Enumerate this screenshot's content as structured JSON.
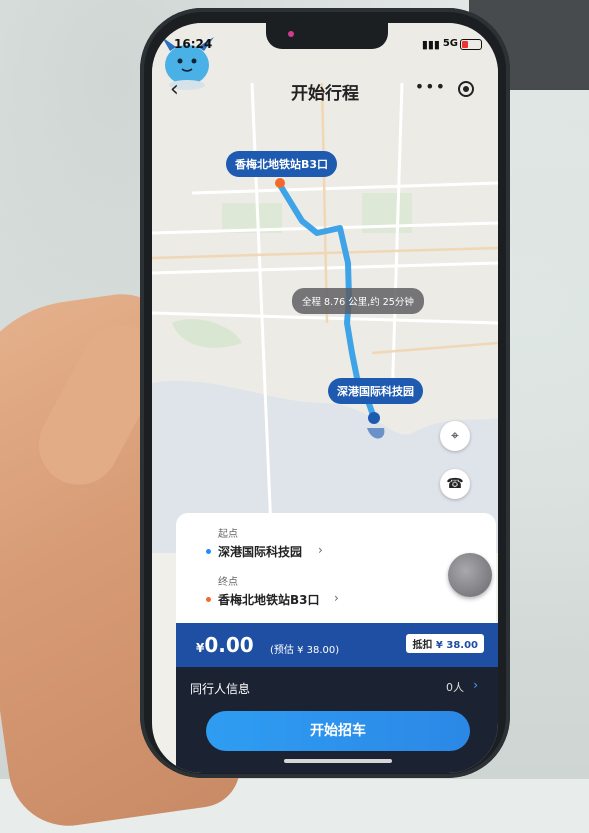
{
  "status_bar": {
    "time": "16:24",
    "network": "5G"
  },
  "header": {
    "title": "开始行程",
    "more_label": "•••"
  },
  "map": {
    "start_bubble": "香梅北地铁站B3口",
    "end_bubble": "深港国际科技园",
    "route_info": "全程 8.76 公里,约 25分钟"
  },
  "trip": {
    "start_label": "起点",
    "start_place": "深港国际科技园",
    "end_label": "终点",
    "end_place": "香梅北地铁站B3口"
  },
  "price": {
    "currency": "¥",
    "amount": "0.00",
    "estimate": "(预估 ¥ 38.00)",
    "deduct_label": "抵扣",
    "deduct_amount": "¥ 38.00"
  },
  "companion": {
    "label": "同行人信息",
    "value": "0人"
  },
  "action": {
    "start_button": "开始招车"
  },
  "colors": {
    "brand": "#1e4fa3",
    "route": "#3fa3e8",
    "start_dot": "#1e8bff",
    "end_dot": "#f26a2a"
  }
}
